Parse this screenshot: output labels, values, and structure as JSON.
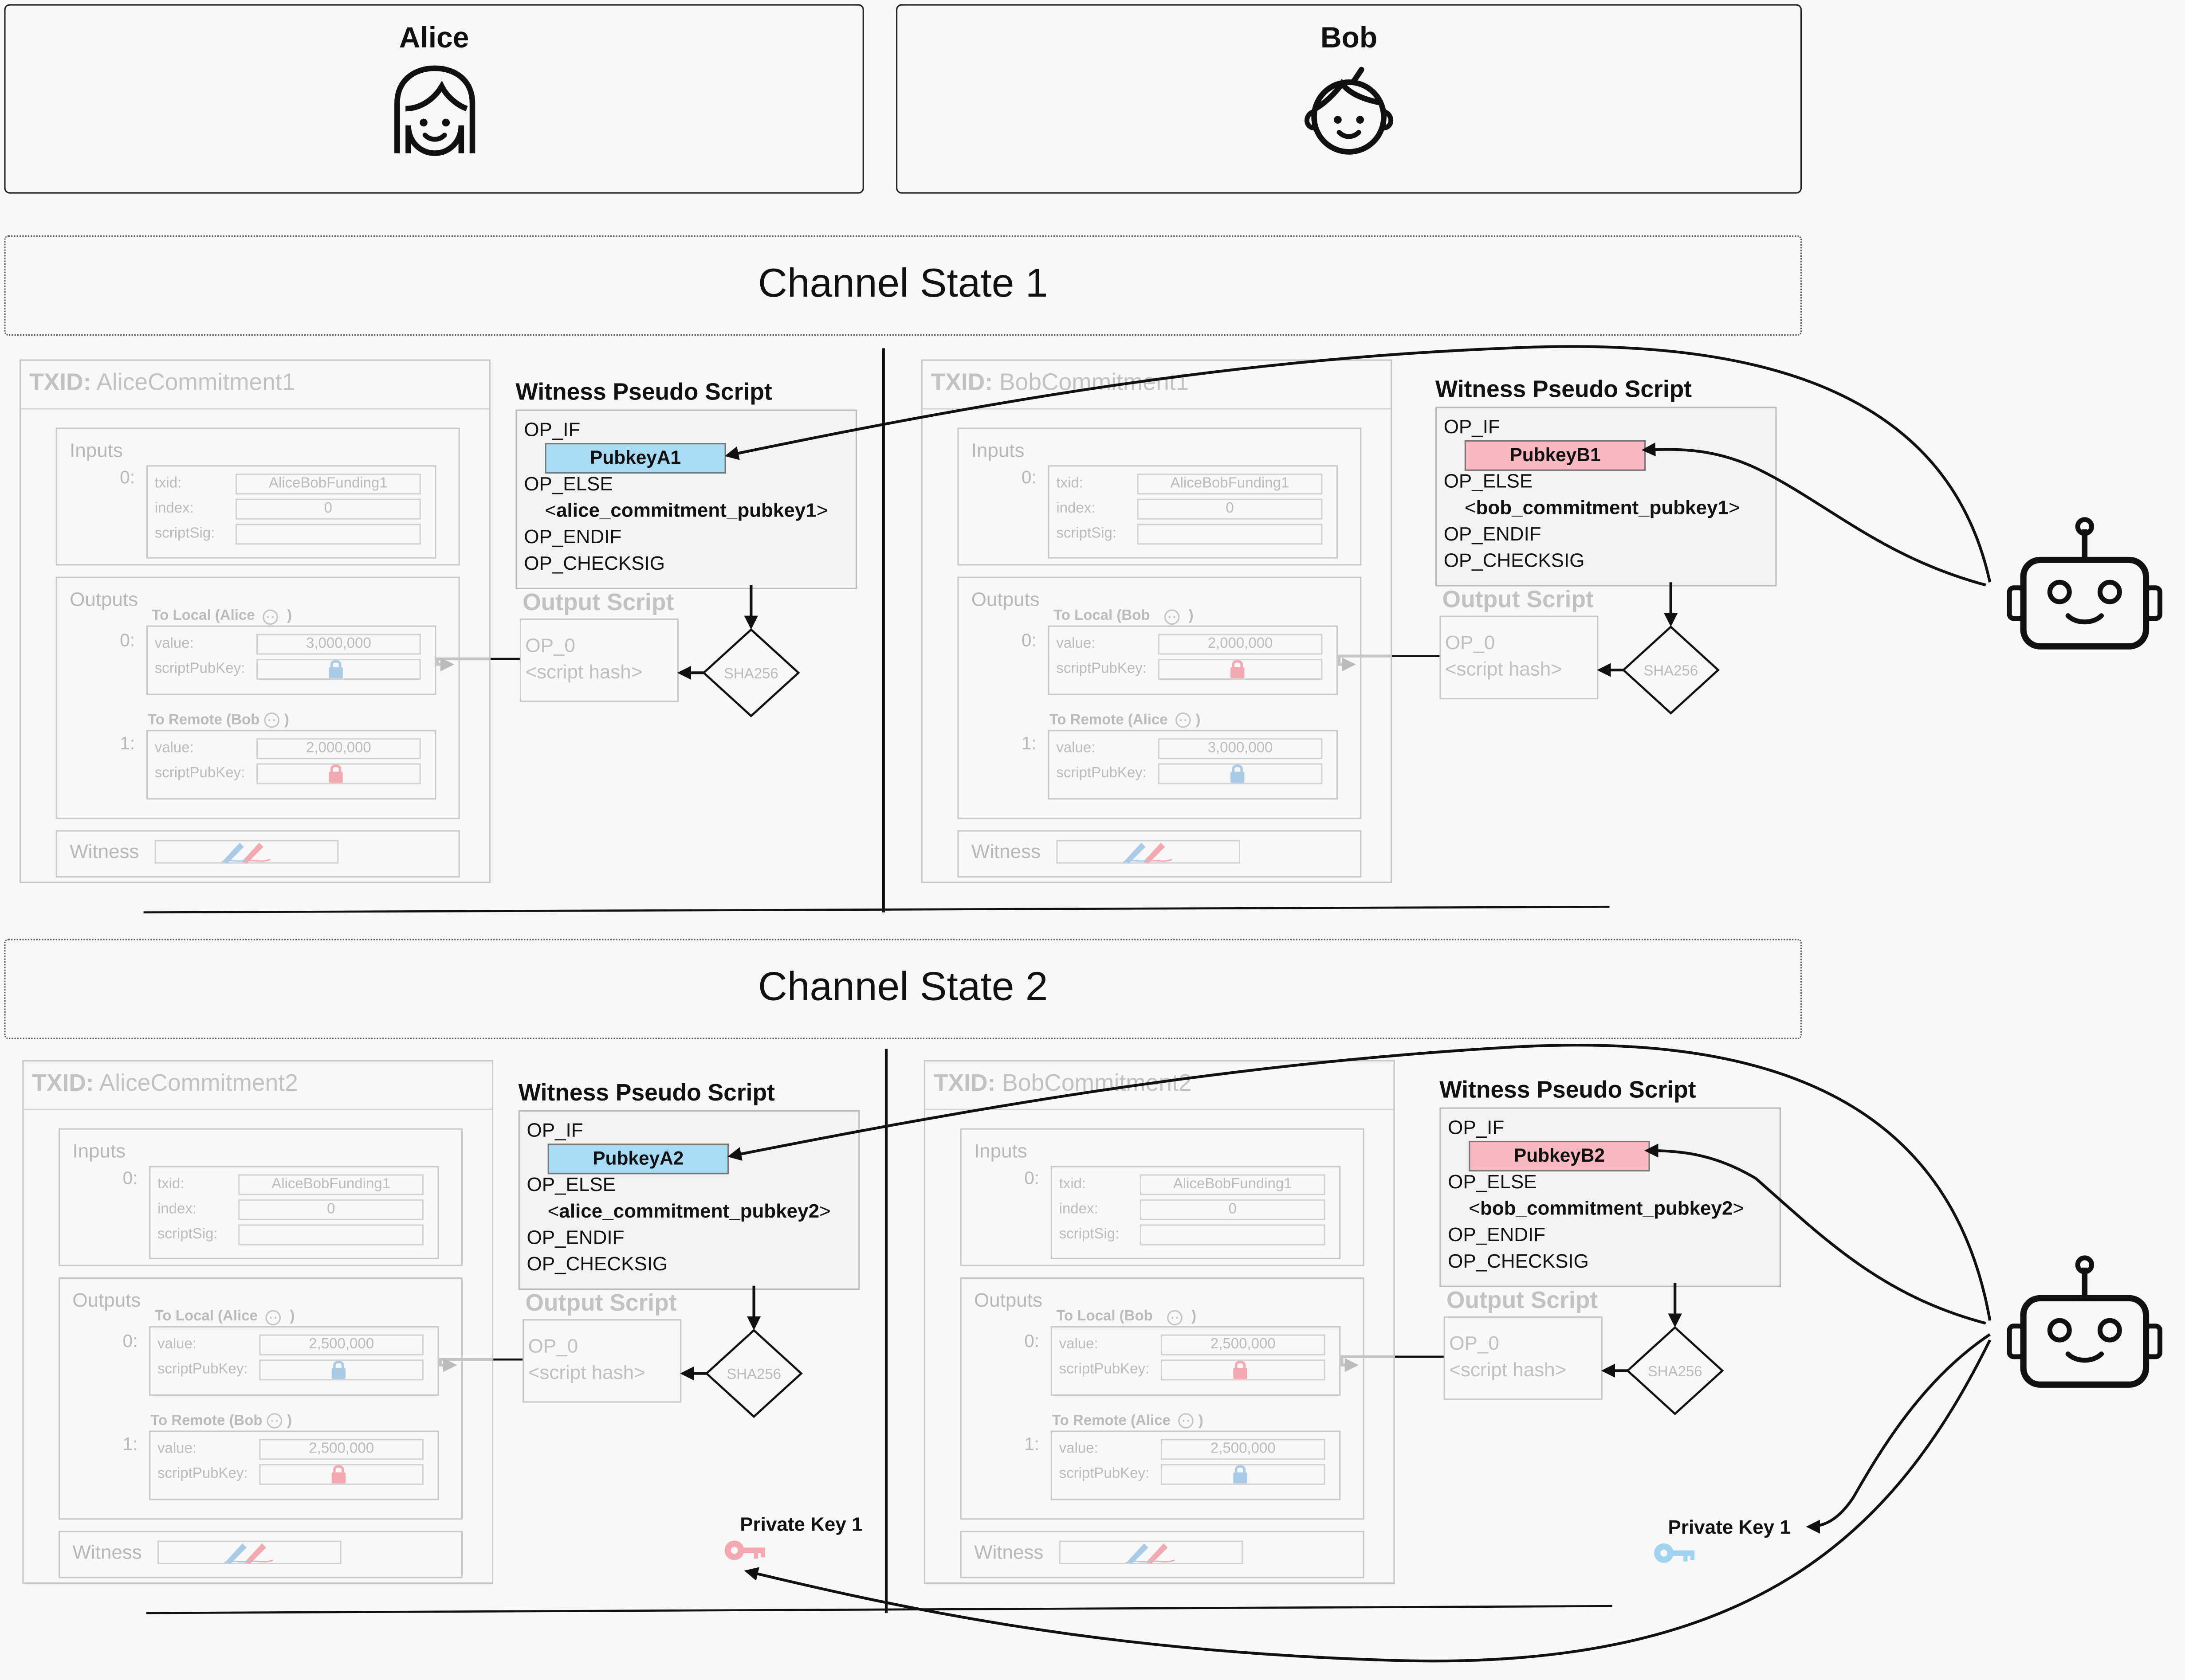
{
  "parties": {
    "alice": {
      "name": "Alice"
    },
    "bob": {
      "name": "Bob"
    }
  },
  "states": [
    {
      "title": "Channel State 1",
      "alice_tx": {
        "txid_prefix": "TXID:",
        "txid": "AliceCommitment1",
        "inputs_label": "Inputs",
        "input_index": "0:",
        "txid_label": "txid:",
        "txid_value": "AliceBobFunding1",
        "index_label": "index:",
        "index_value": "0",
        "scriptsig_label": "scriptSig:",
        "outputs_label": "Outputs",
        "to_local": "To Local (Alice",
        "to_local_close": ")",
        "out0_index": "0:",
        "out0_value_label": "value:",
        "out0_value": "3,000,000",
        "out0_spk_label": "scriptPubKey:",
        "to_remote": "To Remote (Bob",
        "to_remote_close": ")",
        "out1_index": "1:",
        "out1_value_label": "value:",
        "out1_value": "2,000,000",
        "out1_spk_label": "scriptPubKey:",
        "witness_label": "Witness"
      },
      "alice_script": {
        "title": "Witness Pseudo Script",
        "op_if": "OP_IF",
        "pubkey": "PubkeyA1",
        "op_else": "OP_ELSE",
        "commit_open": "<",
        "commit_key": "alice_commitment_pubkey1",
        "commit_close": ">",
        "op_endif": "OP_ENDIF",
        "op_checksig": "OP_CHECKSIG",
        "output_script_title": "Output Script",
        "op_0": "OP_0",
        "script_hash": "<script hash>",
        "sha": "SHA256"
      },
      "bob_tx": {
        "txid_prefix": "TXID:",
        "txid": "BobCommitment1",
        "inputs_label": "Inputs",
        "input_index": "0:",
        "txid_label": "txid:",
        "txid_value": "AliceBobFunding1",
        "index_label": "index:",
        "index_value": "0",
        "scriptsig_label": "scriptSig:",
        "outputs_label": "Outputs",
        "to_local": "To Local (Bob",
        "to_local_close": ")",
        "out0_index": "0:",
        "out0_value_label": "value:",
        "out0_value": "2,000,000",
        "out0_spk_label": "scriptPubKey:",
        "to_remote": "To Remote (Alice",
        "to_remote_close": ")",
        "out1_index": "1:",
        "out1_value_label": "value:",
        "out1_value": "3,000,000",
        "out1_spk_label": "scriptPubKey:",
        "witness_label": "Witness"
      },
      "bob_script": {
        "title": "Witness Pseudo Script",
        "op_if": "OP_IF",
        "pubkey": "PubkeyB1",
        "op_else": "OP_ELSE",
        "commit_open": "<",
        "commit_key": "bob_commitment_pubkey1",
        "commit_close": ">",
        "op_endif": "OP_ENDIF",
        "op_checksig": "OP_CHECKSIG",
        "output_script_title": "Output Script",
        "op_0": "OP_0",
        "script_hash": "<script hash>",
        "sha": "SHA256"
      }
    },
    {
      "title": "Channel State 2",
      "alice_tx": {
        "txid_prefix": "TXID:",
        "txid": "AliceCommitment2",
        "inputs_label": "Inputs",
        "input_index": "0:",
        "txid_label": "txid:",
        "txid_value": "AliceBobFunding1",
        "index_label": "index:",
        "index_value": "0",
        "scriptsig_label": "scriptSig:",
        "outputs_label": "Outputs",
        "to_local": "To Local (Alice",
        "to_local_close": ")",
        "out0_index": "0:",
        "out0_value_label": "value:",
        "out0_value": "2,500,000",
        "out0_spk_label": "scriptPubKey:",
        "to_remote": "To Remote (Bob",
        "to_remote_close": ")",
        "out1_index": "1:",
        "out1_value_label": "value:",
        "out1_value": "2,500,000",
        "out1_spk_label": "scriptPubKey:",
        "witness_label": "Witness"
      },
      "alice_script": {
        "title": "Witness Pseudo Script",
        "op_if": "OP_IF",
        "pubkey": "PubkeyA2",
        "op_else": "OP_ELSE",
        "commit_open": "<",
        "commit_key": "alice_commitment_pubkey2",
        "commit_close": ">",
        "op_endif": "OP_ENDIF",
        "op_checksig": "OP_CHECKSIG",
        "output_script_title": "Output Script",
        "op_0": "OP_0",
        "script_hash": "<script hash>",
        "sha": "SHA256"
      },
      "bob_tx": {
        "txid_prefix": "TXID:",
        "txid": "BobCommitment2",
        "inputs_label": "Inputs",
        "input_index": "0:",
        "txid_label": "txid:",
        "txid_value": "AliceBobFunding1",
        "index_label": "index:",
        "index_value": "0",
        "scriptsig_label": "scriptSig:",
        "outputs_label": "Outputs",
        "to_local": "To Local (Bob",
        "to_local_close": ")",
        "out0_index": "0:",
        "out0_value_label": "value:",
        "out0_value": "2,500,000",
        "out0_spk_label": "scriptPubKey:",
        "to_remote": "To Remote (Alice",
        "to_remote_close": ")",
        "out1_index": "1:",
        "out1_value_label": "value:",
        "out1_value": "2,500,000",
        "out1_spk_label": "scriptPubKey:",
        "witness_label": "Witness"
      },
      "bob_script": {
        "title": "Witness Pseudo Script",
        "op_if": "OP_IF",
        "pubkey": "PubkeyB2",
        "op_else": "OP_ELSE",
        "commit_open": "<",
        "commit_key": "bob_commitment_pubkey2",
        "commit_close": ">",
        "op_endif": "OP_ENDIF",
        "op_checksig": "OP_CHECKSIG",
        "output_script_title": "Output Script",
        "op_0": "OP_0",
        "script_hash": "<script hash>",
        "sha": "SHA256"
      }
    }
  ],
  "private_keys": {
    "alice": {
      "label": "Private Key 1"
    },
    "bob": {
      "label": "Private Key 1"
    }
  },
  "colors": {
    "alice_key": "#f4a9b0",
    "bob_key": "#9fd3f0",
    "pubkey_a": "#a8dcf6",
    "pubkey_b": "#f8b8bf",
    "alice_lock": "#f2aab0",
    "bob_lock": "#a9cbe8",
    "line": "#111111",
    "faded": "#c4c4c4"
  },
  "icons": {
    "alice": "alice-face-icon",
    "bob": "bob-face-icon",
    "robot": "robot-icon",
    "lock": "lock-icon",
    "key": "key-icon",
    "pen": "pen-icon"
  }
}
